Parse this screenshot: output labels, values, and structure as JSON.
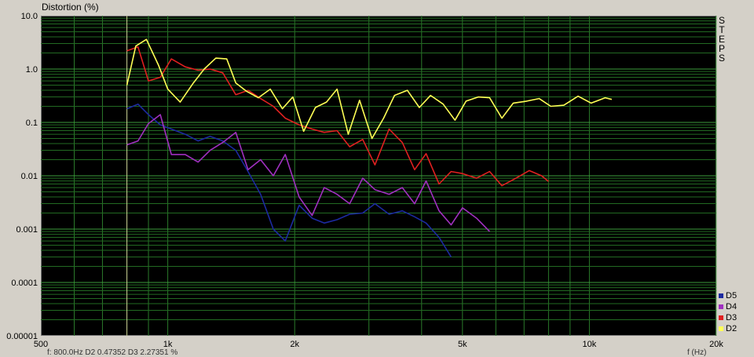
{
  "chart_data": {
    "type": "line",
    "ylabel": "Distortion (%)",
    "xlabel": "f (Hz)",
    "yscale": "log",
    "xscale": "log",
    "xlim": [
      500,
      20000
    ],
    "ylim": [
      1e-05,
      10
    ],
    "x_ticks": [
      {
        "value": 500,
        "label": "500"
      },
      {
        "value": 1000,
        "label": "1k"
      },
      {
        "value": 2000,
        "label": "2k"
      },
      {
        "value": 5000,
        "label": "5k"
      },
      {
        "value": 10000,
        "label": "10k"
      },
      {
        "value": 20000,
        "label": "20k"
      }
    ],
    "y_ticks": [
      {
        "value": 10,
        "label": "10.0"
      },
      {
        "value": 1,
        "label": "1.0"
      },
      {
        "value": 0.1,
        "label": "0.1"
      },
      {
        "value": 0.01,
        "label": "0.01"
      },
      {
        "value": 0.001,
        "label": "0.001"
      },
      {
        "value": 0.0001,
        "label": "0.0001"
      },
      {
        "value": 1e-05,
        "label": "0.00001"
      }
    ],
    "grid": true,
    "cursor_x": 800,
    "legend_position": "bottom-right",
    "series": [
      {
        "name": "D2",
        "color": "#ffff55",
        "x": [
          800,
          840,
          890,
          950,
          1000,
          1070,
          1150,
          1220,
          1300,
          1380,
          1450,
          1540,
          1640,
          1750,
          1870,
          1980,
          2100,
          2240,
          2380,
          2520,
          2680,
          2850,
          3050,
          3250,
          3450,
          3700,
          3950,
          4200,
          4500,
          4800,
          5100,
          5450,
          5800,
          6200,
          6600,
          7100,
          7600,
          8100,
          8700,
          9400,
          10100,
          10900,
          11300
        ],
        "y": [
          0.5,
          2.7,
          3.6,
          1.2,
          0.42,
          0.24,
          0.55,
          1.0,
          1.6,
          1.55,
          0.55,
          0.38,
          0.29,
          0.42,
          0.18,
          0.3,
          0.068,
          0.19,
          0.24,
          0.42,
          0.06,
          0.26,
          0.05,
          0.12,
          0.32,
          0.4,
          0.19,
          0.32,
          0.22,
          0.11,
          0.25,
          0.3,
          0.29,
          0.12,
          0.23,
          0.25,
          0.28,
          0.2,
          0.21,
          0.31,
          0.23,
          0.29,
          0.27
        ]
      },
      {
        "name": "D3",
        "color": "#e02020",
        "x": [
          800,
          850,
          900,
          960,
          1020,
          1100,
          1180,
          1260,
          1350,
          1450,
          1550,
          1660,
          1780,
          1900,
          2050,
          2200,
          2350,
          2520,
          2700,
          2900,
          3100,
          3350,
          3600,
          3850,
          4100,
          4400,
          4700,
          5000,
          5400,
          5800,
          6200,
          6700,
          7200,
          7700,
          8000
        ],
        "y": [
          2.2,
          2.6,
          0.6,
          0.7,
          1.55,
          1.1,
          0.95,
          1.0,
          0.85,
          0.33,
          0.4,
          0.28,
          0.2,
          0.12,
          0.09,
          0.075,
          0.065,
          0.07,
          0.035,
          0.048,
          0.016,
          0.075,
          0.042,
          0.013,
          0.026,
          0.007,
          0.012,
          0.011,
          0.009,
          0.012,
          0.0065,
          0.009,
          0.0125,
          0.01,
          0.0078
        ]
      },
      {
        "name": "D4",
        "color": "#a030c0",
        "x": [
          800,
          850,
          900,
          960,
          1020,
          1100,
          1180,
          1260,
          1350,
          1450,
          1550,
          1660,
          1780,
          1900,
          2050,
          2200,
          2350,
          2520,
          2700,
          2900,
          3100,
          3350,
          3600,
          3850,
          4100,
          4400,
          4700,
          5000,
          5400,
          5800
        ],
        "y": [
          0.038,
          0.045,
          0.095,
          0.14,
          0.025,
          0.025,
          0.018,
          0.03,
          0.042,
          0.065,
          0.013,
          0.02,
          0.01,
          0.025,
          0.004,
          0.0018,
          0.006,
          0.0045,
          0.003,
          0.009,
          0.0055,
          0.0045,
          0.006,
          0.003,
          0.008,
          0.0022,
          0.0012,
          0.0025,
          0.0016,
          0.0009
        ]
      },
      {
        "name": "D5",
        "color": "#1c2aa0",
        "x": [
          800,
          850,
          900,
          960,
          1020,
          1100,
          1180,
          1260,
          1350,
          1450,
          1550,
          1660,
          1780,
          1900,
          2050,
          2200,
          2350,
          2520,
          2700,
          2900,
          3100,
          3350,
          3600,
          3850,
          4100,
          4400,
          4700
        ],
        "y": [
          0.18,
          0.22,
          0.14,
          0.09,
          0.075,
          0.06,
          0.045,
          0.055,
          0.045,
          0.03,
          0.012,
          0.0045,
          0.001,
          0.0006,
          0.0028,
          0.0016,
          0.0013,
          0.0015,
          0.0019,
          0.002,
          0.003,
          0.0019,
          0.0022,
          0.0017,
          0.0013,
          0.0007,
          0.0003
        ]
      }
    ]
  },
  "side_label": [
    "S",
    "T",
    "E",
    "P",
    "S"
  ],
  "legend": [
    {
      "label": "D5",
      "color": "#1c2aa0"
    },
    {
      "label": "D4",
      "color": "#a030c0"
    },
    {
      "label": "D3",
      "color": "#e02020"
    },
    {
      "label": "D2",
      "color": "#ffff55"
    }
  ],
  "readout": {
    "text": "f: 800.0Hz    D2 0.47352  D3 2.27351 %",
    "units": "f (Hz)"
  }
}
